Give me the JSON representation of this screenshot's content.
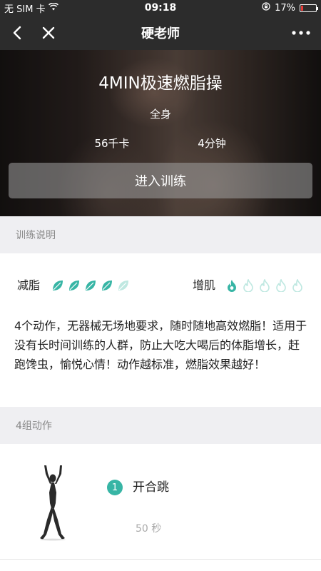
{
  "status_bar": {
    "carrier": "无 SIM 卡",
    "time": "09:18",
    "battery": "17%",
    "battery_level": 0.17,
    "icons": [
      "wifi-icon",
      "rotation-lock-icon",
      "battery-icon"
    ]
  },
  "nav": {
    "title": "硬老师",
    "icons": [
      "back-icon",
      "close-icon",
      "more-icon"
    ]
  },
  "hero": {
    "title": "4MIN极速燃脂操",
    "body_part": "全身",
    "calories": "56千卡",
    "duration": "4分钟",
    "enter_button": "进入训练"
  },
  "instructions": {
    "header": "训练说明",
    "fat_loss": {
      "label": "减脂",
      "level": 4,
      "max": 5,
      "icon": "leaf-icon"
    },
    "muscle_gain": {
      "label": "增肌",
      "level": 1,
      "max": 5,
      "icon": "flame-icon"
    },
    "description": " 4个动作，无器械无场地要求，随时随地高效燃脂！适用于没有长时间训练的人群，防止大吃大喝后的体脂增长，赶跑馋虫，愉悦心情！动作越标准，燃脂效果越好！"
  },
  "exercises": {
    "header": "4组动作",
    "items": [
      {
        "index": "1",
        "name": "开合跳",
        "duration": "50 秒"
      }
    ]
  },
  "colors": {
    "accent": "#37b5a5",
    "accent_light": "#bfe8e1",
    "bar_bg": "#2c2c2c",
    "section_bg": "#efeff2"
  }
}
